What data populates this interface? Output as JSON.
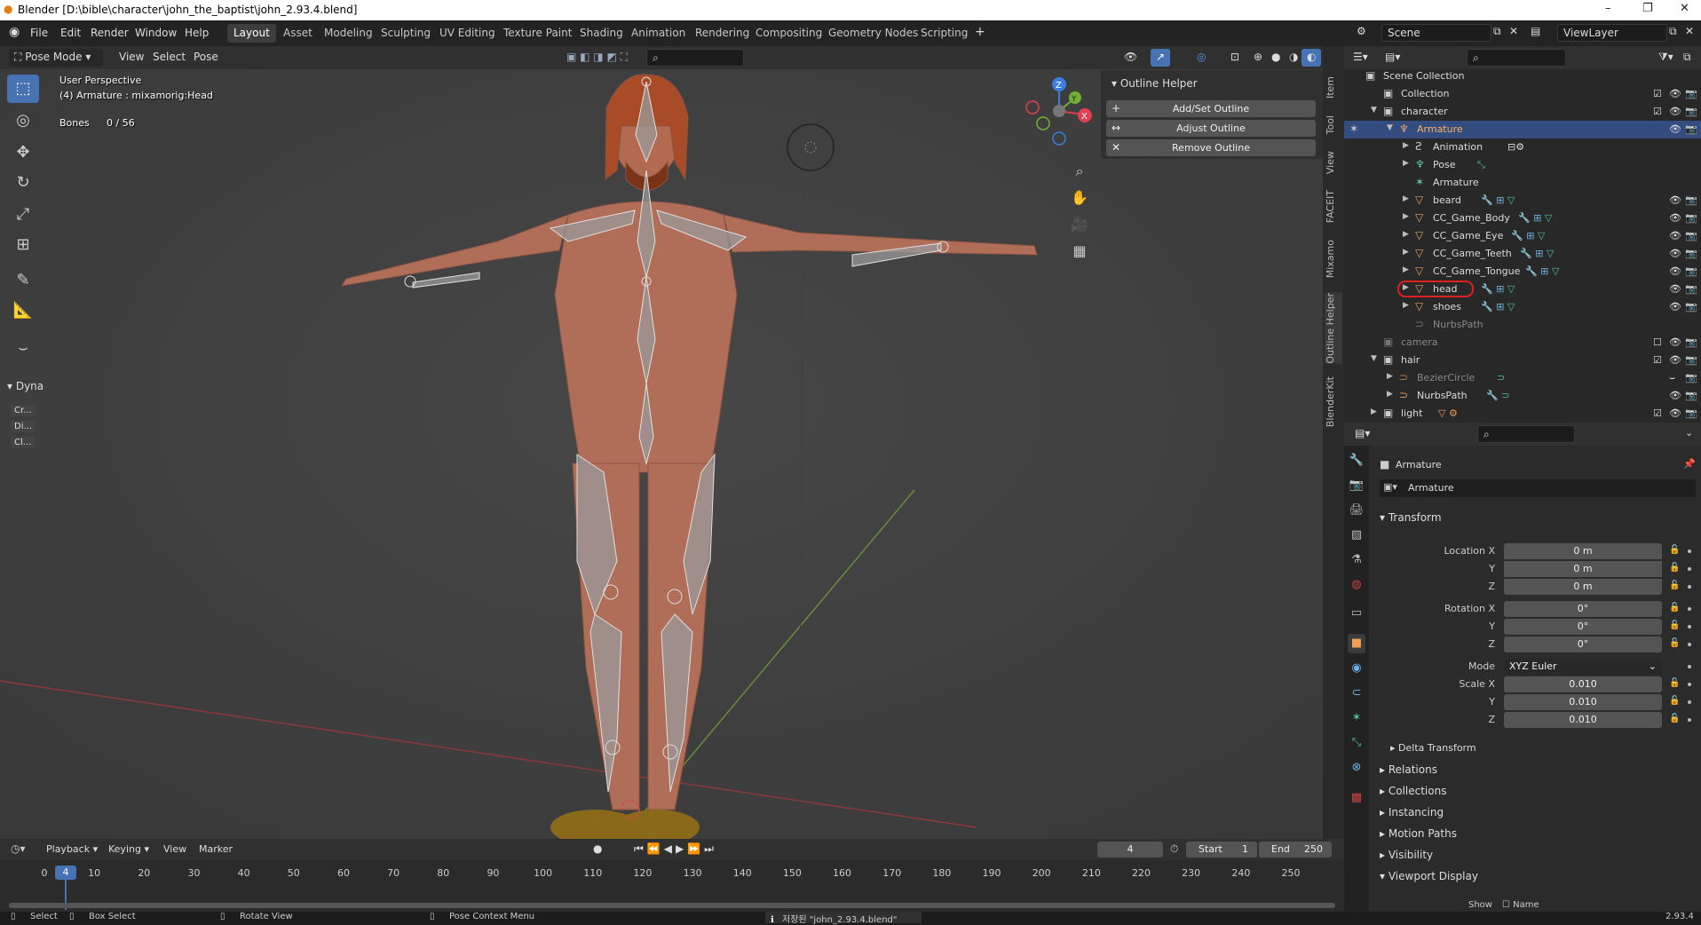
{
  "window": {
    "title": "Blender [D:\\bible\\character\\john_the_baptist\\john_2.93.4.blend]"
  },
  "menu": [
    "File",
    "Edit",
    "Render",
    "Window",
    "Help"
  ],
  "workspaces": [
    "Layout",
    "Asset",
    "Modeling",
    "Sculpting",
    "UV Editing",
    "Texture Paint",
    "Shading",
    "Animation",
    "Rendering",
    "Compositing",
    "Geometry Nodes",
    "Scripting"
  ],
  "scene": {
    "scene_name": "Scene",
    "view_layer": "ViewLayer"
  },
  "viewport": {
    "mode": "Pose Mode",
    "menus": [
      "View",
      "Select",
      "Pose"
    ],
    "overlay": {
      "perspective": "User Perspective",
      "object": "(4) Armature : mixamorig:Head",
      "bones_label": "Bones",
      "bones_value": "0 / 56"
    },
    "toolbar_panel": {
      "label": "Dyna",
      "items": [
        "Cr...",
        "Di...",
        "Cl..."
      ]
    },
    "gizmo": {
      "z": "Z",
      "y": "Y",
      "x": "X"
    }
  },
  "outline_helper": {
    "title": "Outline Helper",
    "buttons": [
      "Add/Set Outline",
      "Adjust Outline",
      "Remove Outline"
    ]
  },
  "sidebar_tabs": [
    "Item",
    "Tool",
    "View",
    "FACEIT",
    "Mixamo",
    "Outline Helper",
    "BlenderKit"
  ],
  "outliner": {
    "rows": [
      {
        "label": "Scene Collection",
        "depth": 0
      },
      {
        "label": "Collection",
        "depth": 1
      },
      {
        "label": "character",
        "depth": 1
      },
      {
        "label": "Armature",
        "depth": 2
      },
      {
        "label": "Animation",
        "depth": 3
      },
      {
        "label": "Pose",
        "depth": 3
      },
      {
        "label": "Armature",
        "depth": 3
      },
      {
        "label": "beard",
        "depth": 3
      },
      {
        "label": "CC_Game_Body",
        "depth": 3
      },
      {
        "label": "CC_Game_Eye",
        "depth": 3
      },
      {
        "label": "CC_Game_Teeth",
        "depth": 3
      },
      {
        "label": "CC_Game_Tongue",
        "depth": 3
      },
      {
        "label": "head",
        "depth": 3
      },
      {
        "label": "shoes",
        "depth": 3
      },
      {
        "label": "NurbsPath",
        "depth": 3
      },
      {
        "label": "camera",
        "depth": 1
      },
      {
        "label": "hair",
        "depth": 1
      },
      {
        "label": "BezierCircle",
        "depth": 2
      },
      {
        "label": "NurbsPath",
        "depth": 2
      },
      {
        "label": "light",
        "depth": 1
      }
    ]
  },
  "properties": {
    "object_name": "Armature",
    "data_name": "Armature",
    "transform": {
      "title": "Transform",
      "location_label": "Location X",
      "location": [
        "0 m",
        "0 m",
        "0 m"
      ],
      "rotation_label": "Rotation X",
      "rotation": [
        "0°",
        "0°",
        "0°"
      ],
      "mode_label": "Mode",
      "mode": "XYZ Euler",
      "scale_label": "Scale X",
      "scale": [
        "0.010",
        "0.010",
        "0.010"
      ],
      "y": "Y",
      "z": "Z"
    },
    "sections": [
      "Delta Transform",
      "Relations",
      "Collections",
      "Instancing",
      "Motion Paths",
      "Visibility",
      "Viewport Display"
    ],
    "cut_labels": [
      "Show",
      "Name"
    ]
  },
  "timeline": {
    "menus": [
      "Playback",
      "Keying",
      "View",
      "Marker"
    ],
    "current_frame": "4",
    "start_label": "Start",
    "start": "1",
    "end_label": "End",
    "end": "250",
    "ticks": [
      "0",
      "10",
      "20",
      "30",
      "40",
      "50",
      "60",
      "70",
      "80",
      "90",
      "100",
      "110",
      "120",
      "130",
      "140",
      "150",
      "160",
      "170",
      "180",
      "190",
      "200",
      "210",
      "220",
      "230",
      "240",
      "250"
    ]
  },
  "status": {
    "select": "Select",
    "box_select": "Box Select",
    "rotate_view": "Rotate View",
    "context_menu": "Pose Context Menu",
    "message": "저장된 \"john_2.93.4.blend\"",
    "version": "2.93.4"
  },
  "colors": {
    "accent": "#4772b3",
    "selected_row": "#334d80",
    "highlight": "#e02020"
  }
}
